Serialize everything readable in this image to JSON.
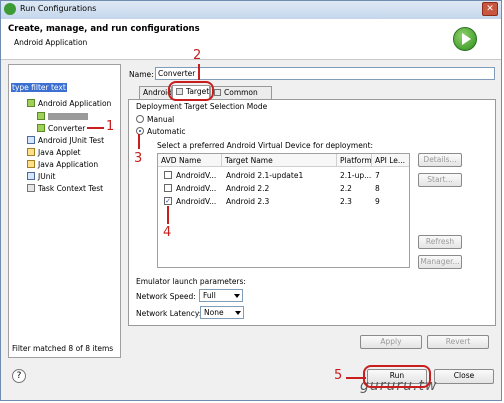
{
  "window": {
    "title": "Run Configurations",
    "close_glyph": "✕"
  },
  "header": {
    "title": "Create, manage, and run configurations",
    "subtitle": "Android Application"
  },
  "left": {
    "filter_text": "type filter text",
    "tree": [
      {
        "label": "Android Application",
        "icon": "android-icon",
        "level": 1
      },
      {
        "label": "",
        "icon": "run-config-icon",
        "level": 2,
        "redacted": true
      },
      {
        "label": "Converter",
        "icon": "run-config-icon",
        "level": 2
      },
      {
        "label": "Android JUnit Test",
        "icon": "junit-icon",
        "level": 1
      },
      {
        "label": "Java Applet",
        "icon": "java-icon",
        "level": 1
      },
      {
        "label": "Java Application",
        "icon": "java-icon",
        "level": 1
      },
      {
        "label": "JUnit",
        "icon": "junit-icon",
        "level": 1
      },
      {
        "label": "Task Context Test",
        "icon": "task-icon",
        "level": 1
      }
    ],
    "status": "Filter matched 8 of 8 items"
  },
  "right": {
    "name_label": "Name:",
    "name_value": "Converter",
    "tabs": [
      {
        "label": "Android"
      },
      {
        "label": "Target",
        "active": true
      },
      {
        "label": "Common"
      }
    ],
    "group_label": "Deployment Target Selection Mode",
    "radio_manual": "Manual",
    "radio_automatic": "Automatic",
    "avd_prompt": "Select a preferred Android Virtual Device for deployment:",
    "columns": [
      "AVD Name",
      "Target Name",
      "Platform",
      "API Le..."
    ],
    "rows": [
      {
        "avd": "AndroidV...",
        "target": "Android 2.1-update1",
        "platform": "2.1-up...",
        "api": "7",
        "checked": false
      },
      {
        "avd": "AndroidV...",
        "target": "Android 2.2",
        "platform": "2.2",
        "api": "8",
        "checked": false
      },
      {
        "avd": "AndroidV...",
        "target": "Android 2.3",
        "platform": "2.3",
        "api": "9",
        "checked": true
      }
    ],
    "side_buttons": [
      "Details...",
      "Start...",
      "Refresh",
      "Manager..."
    ],
    "emulator_label": "Emulator launch parameters:",
    "network_speed_label": "Network Speed:",
    "network_speed_value": "Full",
    "network_latency_label": "Network Latency:",
    "network_latency_value": "None",
    "apply": "Apply",
    "revert": "Revert"
  },
  "footer": {
    "help_glyph": "?",
    "run": "Run",
    "close": "Close"
  },
  "annotations": [
    "1",
    "2",
    "3",
    "4",
    "5"
  ],
  "watermark": "gururu.tw",
  "colors": {
    "annotation": "#c81e1e",
    "selection": "#3b6fd1"
  }
}
